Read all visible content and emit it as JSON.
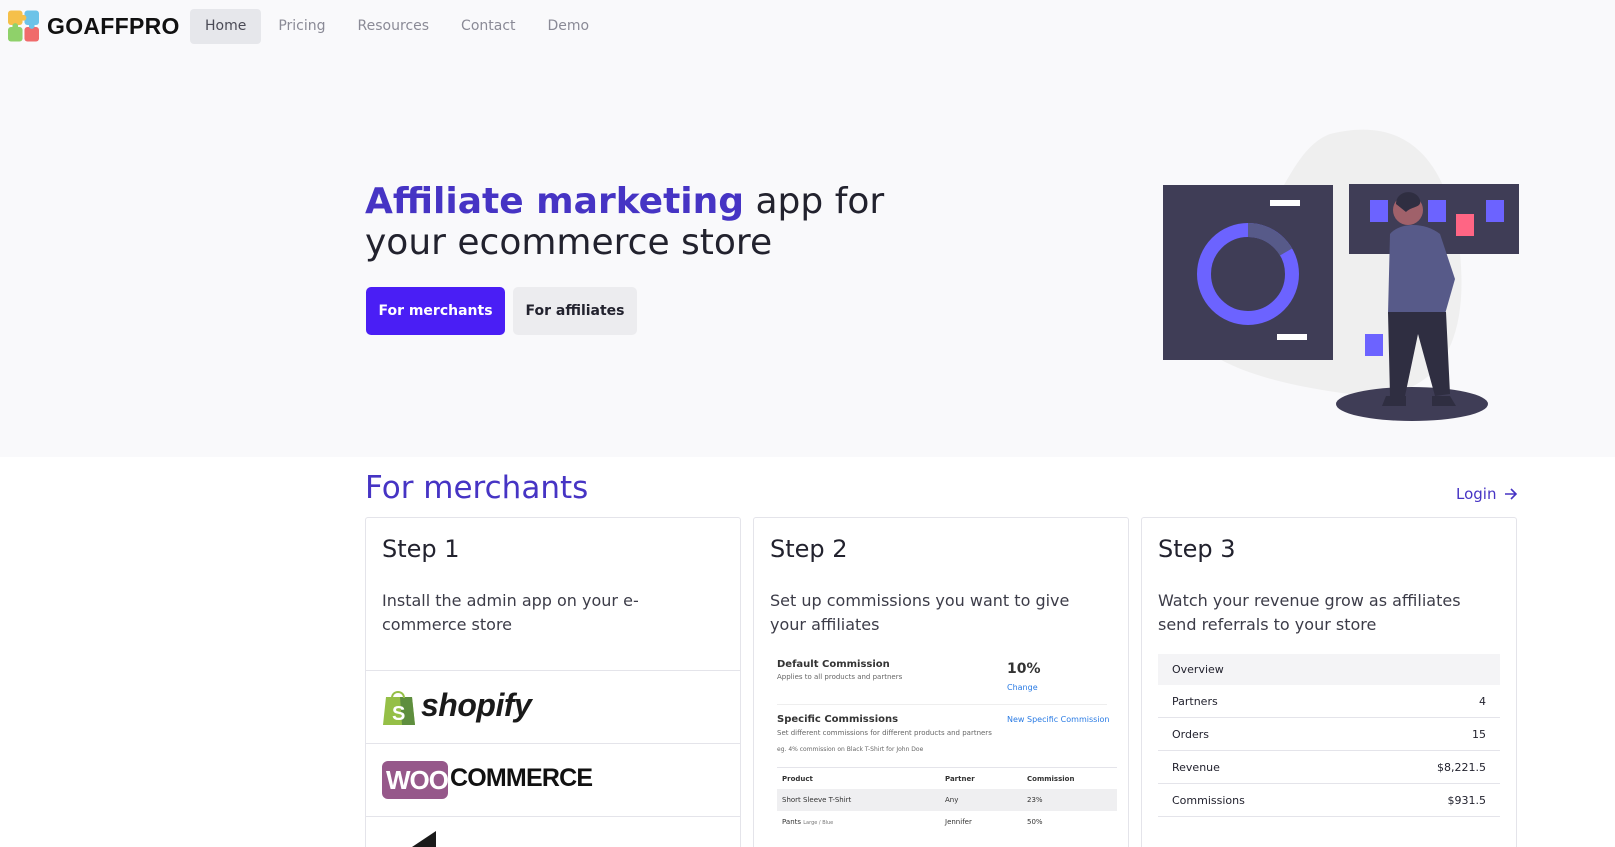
{
  "brand": {
    "name": "GOAFFPRO"
  },
  "nav": {
    "items": [
      "Home",
      "Pricing",
      "Resources",
      "Contact",
      "Demo"
    ],
    "active": "Home"
  },
  "hero": {
    "title_strong": "Affiliate marketing",
    "title_rest_line1": " app for",
    "title_line2": "your ecommerce store",
    "btn_merchants": "For merchants",
    "btn_affiliates": "For affiliates"
  },
  "merchants": {
    "title": "For merchants",
    "login": "Login",
    "steps": [
      {
        "title": "Step 1",
        "desc": "Install the admin app on your e-commerce store"
      },
      {
        "title": "Step 2",
        "desc": "Set up commissions you want to give your affiliates"
      },
      {
        "title": "Step 3",
        "desc": "Watch your revenue grow as affiliates send referrals to your store"
      }
    ],
    "platforms": [
      "shopify",
      "WOO",
      "COMMERCE"
    ],
    "commission": {
      "default_label": "Default Commission",
      "default_sub": "Applies to all products and partners",
      "default_value": "10%",
      "change": "Change",
      "specific_label": "Specific Commissions",
      "specific_sub": "Set different commissions for different products and partners",
      "specific_eg": "eg. 4% commission on Black T-Shirt for John Doe",
      "new_specific": "New Specific Commission",
      "columns": [
        "Product",
        "Partner",
        "Commission"
      ],
      "rows": [
        {
          "product": "Short Sleeve T-Shirt",
          "variant": "",
          "partner": "Any",
          "commission": "23%"
        },
        {
          "product": "Pants",
          "variant": "Large / Blue",
          "partner": "Jennifer",
          "commission": "50%"
        }
      ]
    },
    "overview": {
      "header": "Overview",
      "rows": [
        {
          "label": "Partners",
          "value": "4"
        },
        {
          "label": "Orders",
          "value": "15"
        },
        {
          "label": "Revenue",
          "value": "$8,221.5"
        },
        {
          "label": "Commissions",
          "value": "$931.5"
        }
      ]
    }
  },
  "colors": {
    "accent": "#4634c4",
    "primary_button": "#4a1ef5",
    "hero_bg": "#f9f9fb",
    "illustration_dark": "#3f3d56",
    "illustration_accent": "#6c63ff"
  }
}
